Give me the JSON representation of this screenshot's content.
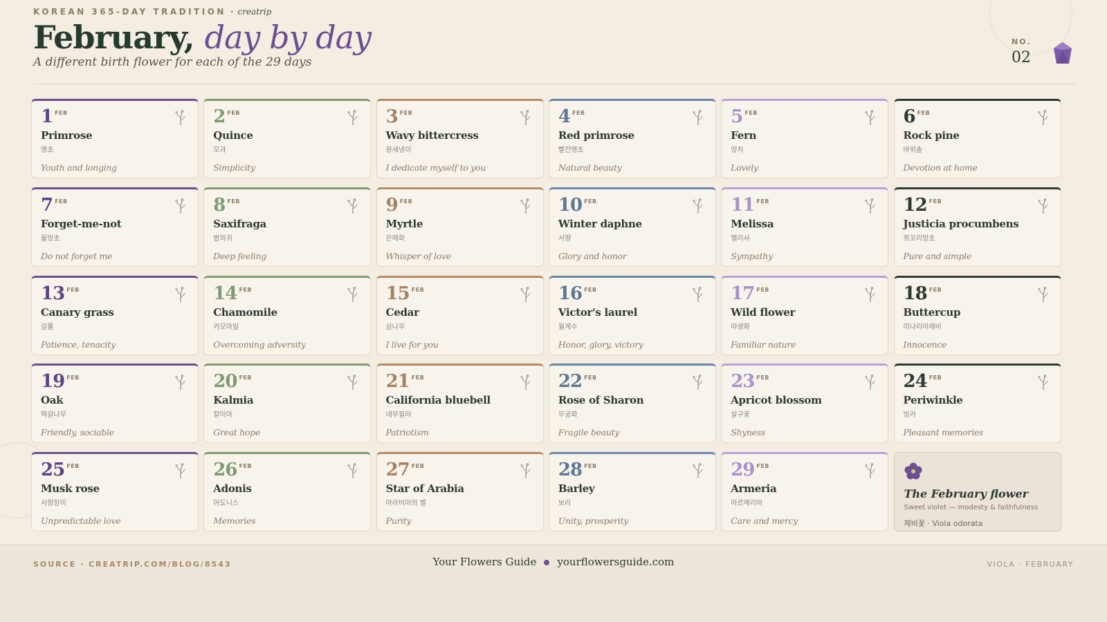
{
  "header": {
    "eyebrow": "KOREAN 365-DAY TRADITION",
    "eyebrow_sep": "·",
    "brand": "creatrip",
    "title_main": "February,",
    "title_accent": "day by day",
    "subtitle": "A different birth flower for each of the 29 days",
    "issue_label": "NO.",
    "issue_number": "02"
  },
  "month_abbr": "FEB",
  "colors": {
    "purple": "#6b4f92",
    "green": "#7f9b74",
    "brown": "#b58a63",
    "blue": "#6a86a8",
    "lilac": "#b6a2d8",
    "dark": "#2c3a33"
  },
  "days": [
    {
      "day": "1",
      "name": "Primrose",
      "korean": "앵초",
      "meaning": "Youth and longing"
    },
    {
      "day": "2",
      "name": "Quince",
      "korean": "모과",
      "meaning": "Simplicity"
    },
    {
      "day": "3",
      "name": "Wavy bittercress",
      "korean": "황새냉이",
      "meaning": "I dedicate myself to you"
    },
    {
      "day": "4",
      "name": "Red primrose",
      "korean": "빨간앵초",
      "meaning": "Natural beauty"
    },
    {
      "day": "5",
      "name": "Fern",
      "korean": "양치",
      "meaning": "Lovely"
    },
    {
      "day": "6",
      "name": "Rock pine",
      "korean": "바위솔",
      "meaning": "Devotion at home"
    },
    {
      "day": "7",
      "name": "Forget-me-not",
      "korean": "물망초",
      "meaning": "Do not forget me"
    },
    {
      "day": "8",
      "name": "Saxifraga",
      "korean": "범의귀",
      "meaning": "Deep feeling"
    },
    {
      "day": "9",
      "name": "Myrtle",
      "korean": "은매화",
      "meaning": "Whisper of love"
    },
    {
      "day": "10",
      "name": "Winter daphne",
      "korean": "서향",
      "meaning": "Glory and honor"
    },
    {
      "day": "11",
      "name": "Melissa",
      "korean": "멜리사",
      "meaning": "Sympathy"
    },
    {
      "day": "12",
      "name": "Justicia procumbens",
      "korean": "쥐꼬리망초",
      "meaning": "Pure and simple"
    },
    {
      "day": "13",
      "name": "Canary grass",
      "korean": "갈풀",
      "meaning": "Patience, tenacity"
    },
    {
      "day": "14",
      "name": "Chamomile",
      "korean": "카모마일",
      "meaning": "Overcoming adversity"
    },
    {
      "day": "15",
      "name": "Cedar",
      "korean": "삼나무",
      "meaning": "I live for you"
    },
    {
      "day": "16",
      "name": "Victor's laurel",
      "korean": "월계수",
      "meaning": "Honor, glory, victory"
    },
    {
      "day": "17",
      "name": "Wild flower",
      "korean": "야생화",
      "meaning": "Familiar nature"
    },
    {
      "day": "18",
      "name": "Buttercup",
      "korean": "미나리아재비",
      "meaning": "Innocence"
    },
    {
      "day": "19",
      "name": "Oak",
      "korean": "떡갈나무",
      "meaning": "Friendly, sociable"
    },
    {
      "day": "20",
      "name": "Kalmia",
      "korean": "칼미아",
      "meaning": "Great hope"
    },
    {
      "day": "21",
      "name": "California bluebell",
      "korean": "네무필라",
      "meaning": "Patriotism"
    },
    {
      "day": "22",
      "name": "Rose of Sharon",
      "korean": "무궁화",
      "meaning": "Fragile beauty"
    },
    {
      "day": "23",
      "name": "Apricot blossom",
      "korean": "살구꽃",
      "meaning": "Shyness"
    },
    {
      "day": "24",
      "name": "Periwinkle",
      "korean": "빙카",
      "meaning": "Pleasant memories"
    },
    {
      "day": "25",
      "name": "Musk rose",
      "korean": "사향장미",
      "meaning": "Unpredictable love"
    },
    {
      "day": "26",
      "name": "Adonis",
      "korean": "아도니스",
      "meaning": "Memories"
    },
    {
      "day": "27",
      "name": "Star of Arabia",
      "korean": "아라비아의 별",
      "meaning": "Purity"
    },
    {
      "day": "28",
      "name": "Barley",
      "korean": "보리",
      "meaning": "Unity, prosperity"
    },
    {
      "day": "29",
      "name": "Armeria",
      "korean": "아르메리아",
      "meaning": "Care and mercy"
    }
  ],
  "month_flower": {
    "icon": "violet-flower-icon",
    "title": "The February flower",
    "subtitle": "Sweet violet — modesty & faithfulness",
    "korean_latin": "제비꽃 · Viola odorata"
  },
  "footer": {
    "source": "SOURCE · CREATRIP.COM/BLOG/8543",
    "guide_name": "Your Flowers Guide",
    "guide_url": "yourflowersguide.com",
    "right_label": "VIOLA · FEBRUARY"
  }
}
